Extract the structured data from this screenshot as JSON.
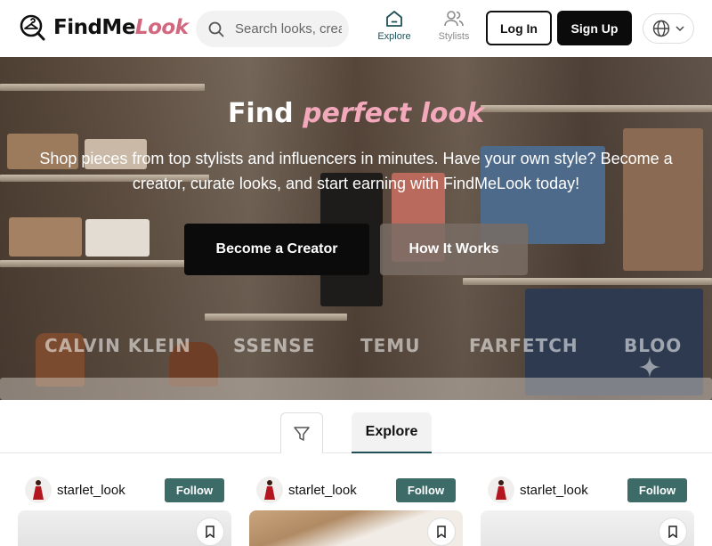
{
  "brand": {
    "name_part1": "FindMe",
    "name_part2": "Look"
  },
  "search": {
    "placeholder": "Search looks, creators"
  },
  "nav": [
    {
      "label": "Explore",
      "icon": "home-icon",
      "active": true
    },
    {
      "label": "Stylists",
      "icon": "users-icon",
      "active": false
    }
  ],
  "auth": {
    "login_label": "Log In",
    "signup_label": "Sign Up"
  },
  "language": {
    "icon": "globe-icon"
  },
  "hero": {
    "title_part1": "Find ",
    "title_accent": "perfect look",
    "subtitle": "Shop pieces from top stylists and influencers in minutes. Have your own style? Become a creator, curate looks, and start earning with FindMeLook today!",
    "cta_primary": "Become a Creator",
    "cta_secondary": "How It Works",
    "brands": [
      "CALVIN KLEIN",
      "SSENSE",
      "TEMU",
      "FARFETCH",
      "BLOO"
    ]
  },
  "tabs": {
    "filter_icon": "filter-icon",
    "active_tab": "Explore"
  },
  "cards": [
    {
      "username": "starlet_look",
      "follow_label": "Follow"
    },
    {
      "username": "starlet_look",
      "follow_label": "Follow"
    },
    {
      "username": "starlet_look",
      "follow_label": "Follow"
    }
  ],
  "colors": {
    "accent": "#d2677e",
    "teal": "#3d6b68",
    "nav_active": "#1f5058"
  }
}
